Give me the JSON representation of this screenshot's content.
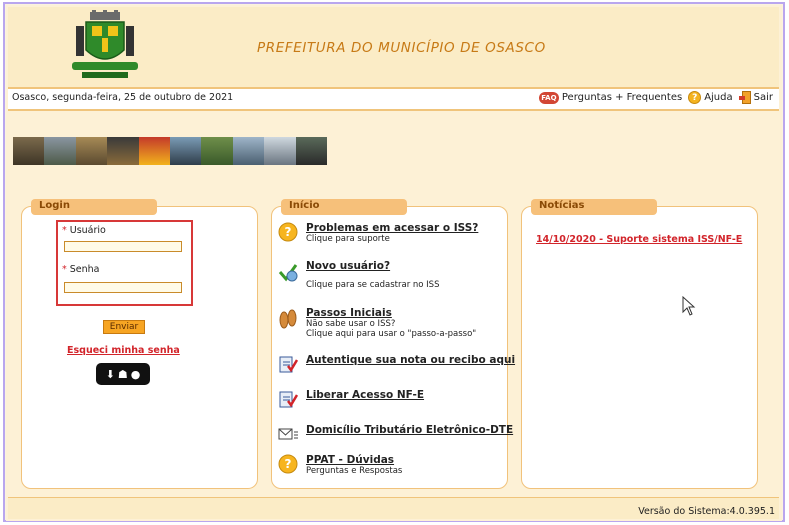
{
  "header": {
    "title": "PREFEITURA DO MUNICÍPIO DE OSASCO"
  },
  "topbar": {
    "date": "Osasco, segunda-feira, 25 de outubro de 2021",
    "faq_label": "Perguntas + Frequentes",
    "help_label": "Ajuda",
    "exit_label": "Sair"
  },
  "login": {
    "tab": "Login",
    "user_label": "Usuário",
    "pass_label": "Senha",
    "submit_label": "Enviar",
    "forgot_label": "Esqueci minha senha"
  },
  "inicio": {
    "tab": "Início",
    "items": [
      {
        "title": "Problemas em acessar o ISS?",
        "sub1": "Clique para suporte",
        "sub2": "",
        "icon": "question-icon"
      },
      {
        "title": "Novo usuário?",
        "sub1": "",
        "sub2": "Clique para se cadastrar no ISS",
        "icon": "new-user-icon"
      },
      {
        "title": "Passos Iniciais",
        "sub1": "Não sabe usar o ISS?",
        "sub2": "Clique aqui para usar o \"passo-a-passo\"",
        "icon": "footprints-icon"
      },
      {
        "title": "Autentique sua nota ou recibo aqui",
        "sub1": "",
        "sub2": "",
        "icon": "document-check-icon"
      },
      {
        "title": "Liberar Acesso NF-E",
        "sub1": "",
        "sub2": "",
        "icon": "document-check-icon"
      },
      {
        "title": "Domicílio Tributário Eletrônico-DTE",
        "sub1": "",
        "sub2": "",
        "icon": "mail-icon"
      },
      {
        "title": "PPAT - Dúvidas",
        "sub1": "Perguntas e Respostas",
        "sub2": "",
        "icon": "question-icon"
      }
    ]
  },
  "noticias": {
    "tab": "Notícias",
    "items": [
      "14/10/2020 - Suporte sistema ISS/NF-E"
    ]
  },
  "footer": {
    "version": "Versão do Sistema:4.0.395.1"
  },
  "colors": {
    "accent_orange": "#f6c07a",
    "title_orange": "#c77a16",
    "link_red": "#d2242a",
    "frame_purple": "#b9a6ee"
  }
}
